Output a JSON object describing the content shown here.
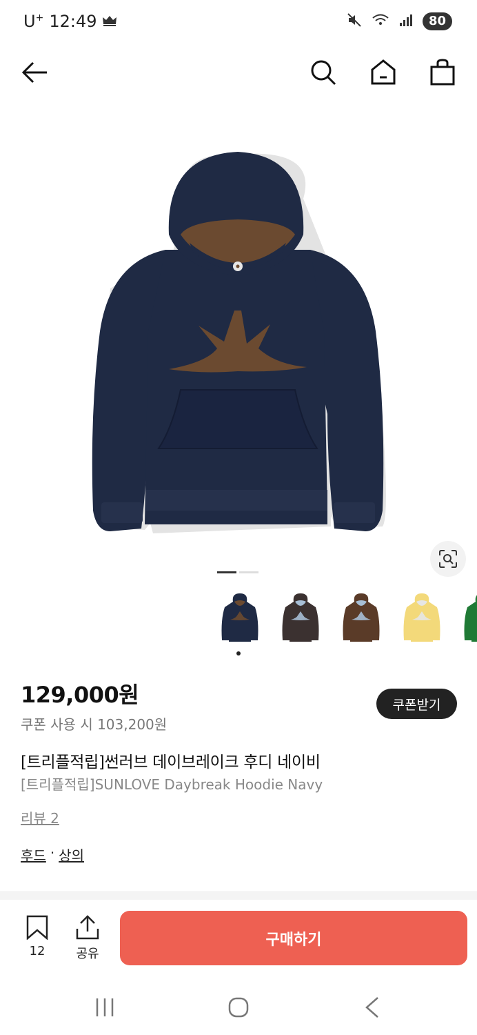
{
  "status_bar": {
    "carrier": "U",
    "carrier_sup": "+",
    "time": "12:49",
    "battery": "80",
    "icons": [
      "crown-icon",
      "mute-icon",
      "wifi-icon",
      "signal-icon"
    ]
  },
  "nav": {
    "icons": [
      "back-arrow-icon",
      "search-icon",
      "home-icon",
      "shopping-bag-icon"
    ]
  },
  "gallery": {
    "current_image": 1,
    "total_images": 2,
    "swatch_colors": [
      "#1f2a44",
      "#3b3130",
      "#5a3b28",
      "#f3d97a",
      "#1f7a35"
    ],
    "accent_colors": [
      "#6b4a30",
      "#a7bfd6",
      "#a7bfd6",
      "#e6e6e6",
      "#1f7a35"
    ]
  },
  "product": {
    "price": "129,000원",
    "coupon_price": "쿠폰 사용 시 103,200원",
    "coupon_button": "쿠폰받기",
    "title_ko": "[트리플적립]썬러브 데이브레이크 후디 네이비",
    "title_en": "[트리플적립]SUNLOVE Daybreak Hoodie Navy",
    "reviews": "리뷰 2",
    "category_1": "후드",
    "category_sep": "·",
    "category_2": "상의"
  },
  "actions": {
    "bookmark_count": "12",
    "share_label": "공유",
    "buy_label": "구매하기"
  },
  "colors": {
    "buy_button": "#ee6052",
    "coupon_button": "#222222",
    "hoodie_body": "#1f2a44",
    "hoodie_accent": "#6b4a30"
  }
}
